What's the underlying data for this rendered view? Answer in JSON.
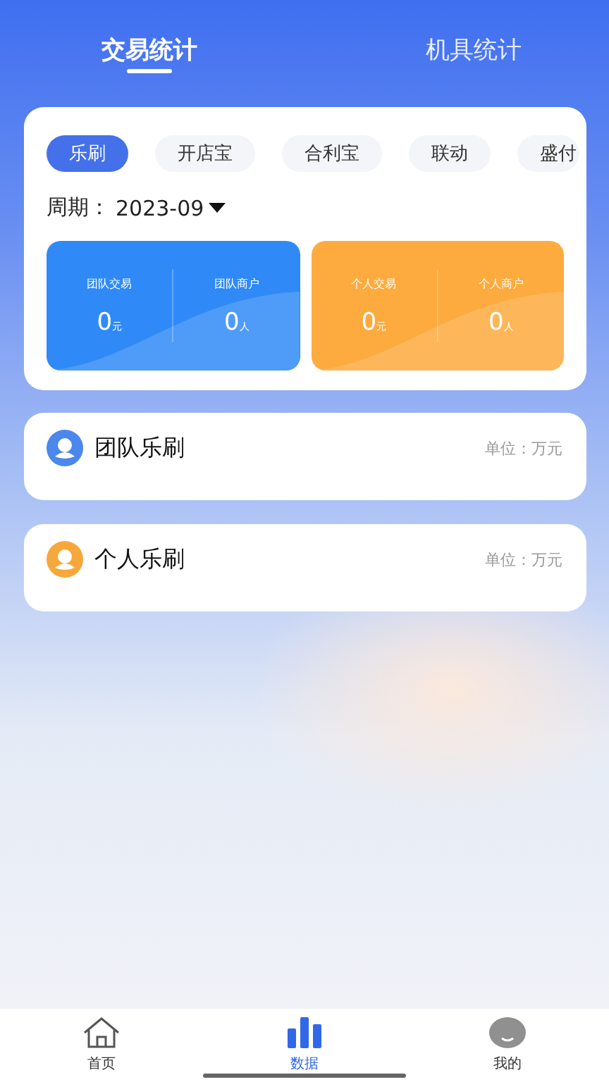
{
  "top_tabs": [
    {
      "label": "交易统计",
      "selected": true
    },
    {
      "label": "机具统计",
      "selected": false
    }
  ],
  "chips": [
    {
      "label": "乐刷",
      "selected": true
    },
    {
      "label": "开店宝",
      "selected": false
    },
    {
      "label": "合利宝",
      "selected": false
    },
    {
      "label": "联动",
      "selected": false
    },
    {
      "label": "盛付",
      "selected": false
    }
  ],
  "period": {
    "label": "周期：",
    "value": "2023-09"
  },
  "stat_cards": [
    {
      "color": "#2f8af7",
      "cells": [
        {
          "label": "团队交易",
          "value": "0",
          "unit": "元"
        },
        {
          "label": "团队商户",
          "value": "0",
          "unit": "人"
        }
      ]
    },
    {
      "color": "#fdab3e",
      "cells": [
        {
          "label": "个人交易",
          "value": "0",
          "unit": "元"
        },
        {
          "label": "个人商户",
          "value": "0",
          "unit": "人"
        }
      ]
    }
  ],
  "sections": [
    {
      "title": "团队乐刷",
      "unit": "单位：万元",
      "color": "#4b87ec"
    },
    {
      "title": "个人乐刷",
      "unit": "单位：万元",
      "color": "#f6a83c"
    }
  ],
  "bottom_nav": [
    {
      "label": "首页",
      "kind": "home",
      "selected": false
    },
    {
      "label": "数据",
      "kind": "chart",
      "selected": true
    },
    {
      "label": "我的",
      "kind": "avatar",
      "selected": false
    }
  ]
}
